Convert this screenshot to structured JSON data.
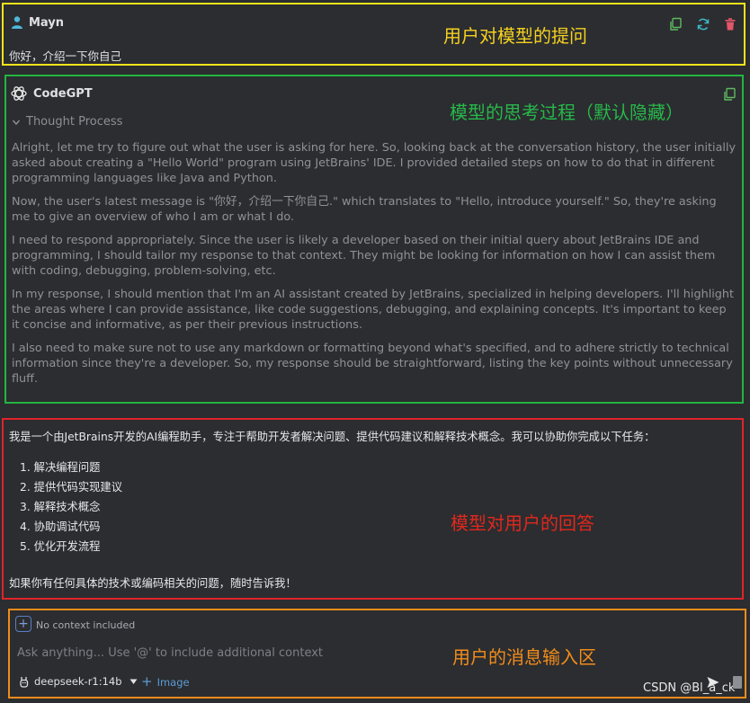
{
  "user_message": {
    "author": "Mayn",
    "text": "你好，介绍一下你自己"
  },
  "annotations": {
    "user_question": "用户对模型的提问",
    "thought_process": "模型的思考过程（默认隐藏）",
    "model_answer": "模型对用户的回答",
    "input_area": "用户的消息输入区"
  },
  "assistant": {
    "name": "CodeGPT",
    "thought_toggle": "Thought Process",
    "thoughts": [
      "Alright, let me try to figure out what the user is asking for here. So, looking back at the conversation history, the user initially asked about creating a \"Hello World\" program using JetBrains' IDE. I provided detailed steps on how to do that in different programming languages like Java and Python.",
      "Now, the user's latest message is \"你好，介绍一下你自己.\" which translates to \"Hello, introduce yourself.\" So, they're asking me to give an overview of who I am or what I do.",
      "I need to respond appropriately. Since the user is likely a developer based on their initial query about JetBrains IDE and programming, I should tailor my response to that context. They might be looking for information on how I can assist them with coding, debugging, problem-solving, etc.",
      "In my response, I should mention that I'm an AI assistant created by JetBrains, specialized in helping developers. I'll highlight the areas where I can provide assistance, like code suggestions, debugging, and explaining concepts. It's important to keep it concise and informative, as per their previous instructions.",
      "I also need to make sure not to use any markdown or formatting beyond what's specified, and to adhere strictly to technical information since they're a developer. So, my response should be straightforward, listing the key points without unnecessary fluff."
    ],
    "answer_intro": "我是一个由JetBrains开发的AI编程助手，专注于帮助开发者解决问题、提供代码建议和解释技术概念。我可以协助你完成以下任务：",
    "answer_items": [
      "1. 解决编程问题",
      "2. 提供代码实现建议",
      "3. 解释技术概念",
      "4. 协助调试代码",
      "5. 优化开发流程"
    ],
    "answer_outro": "如果你有任何具体的技术或编码相关的问题，随时告诉我！"
  },
  "input": {
    "context_label": "No context included",
    "placeholder": "Ask anything... Use '@' to include additional context",
    "model": "deepseek-r1:14b",
    "image_label": "Image"
  },
  "watermark": "CSDN @Bl_a_ck",
  "colors": {
    "user_box_border": "#f5e31a",
    "thought_box_border": "#23b540",
    "answer_box_border": "#e0232a",
    "input_box_border": "#f28c1b",
    "accent_blue": "#5b9bd5"
  }
}
